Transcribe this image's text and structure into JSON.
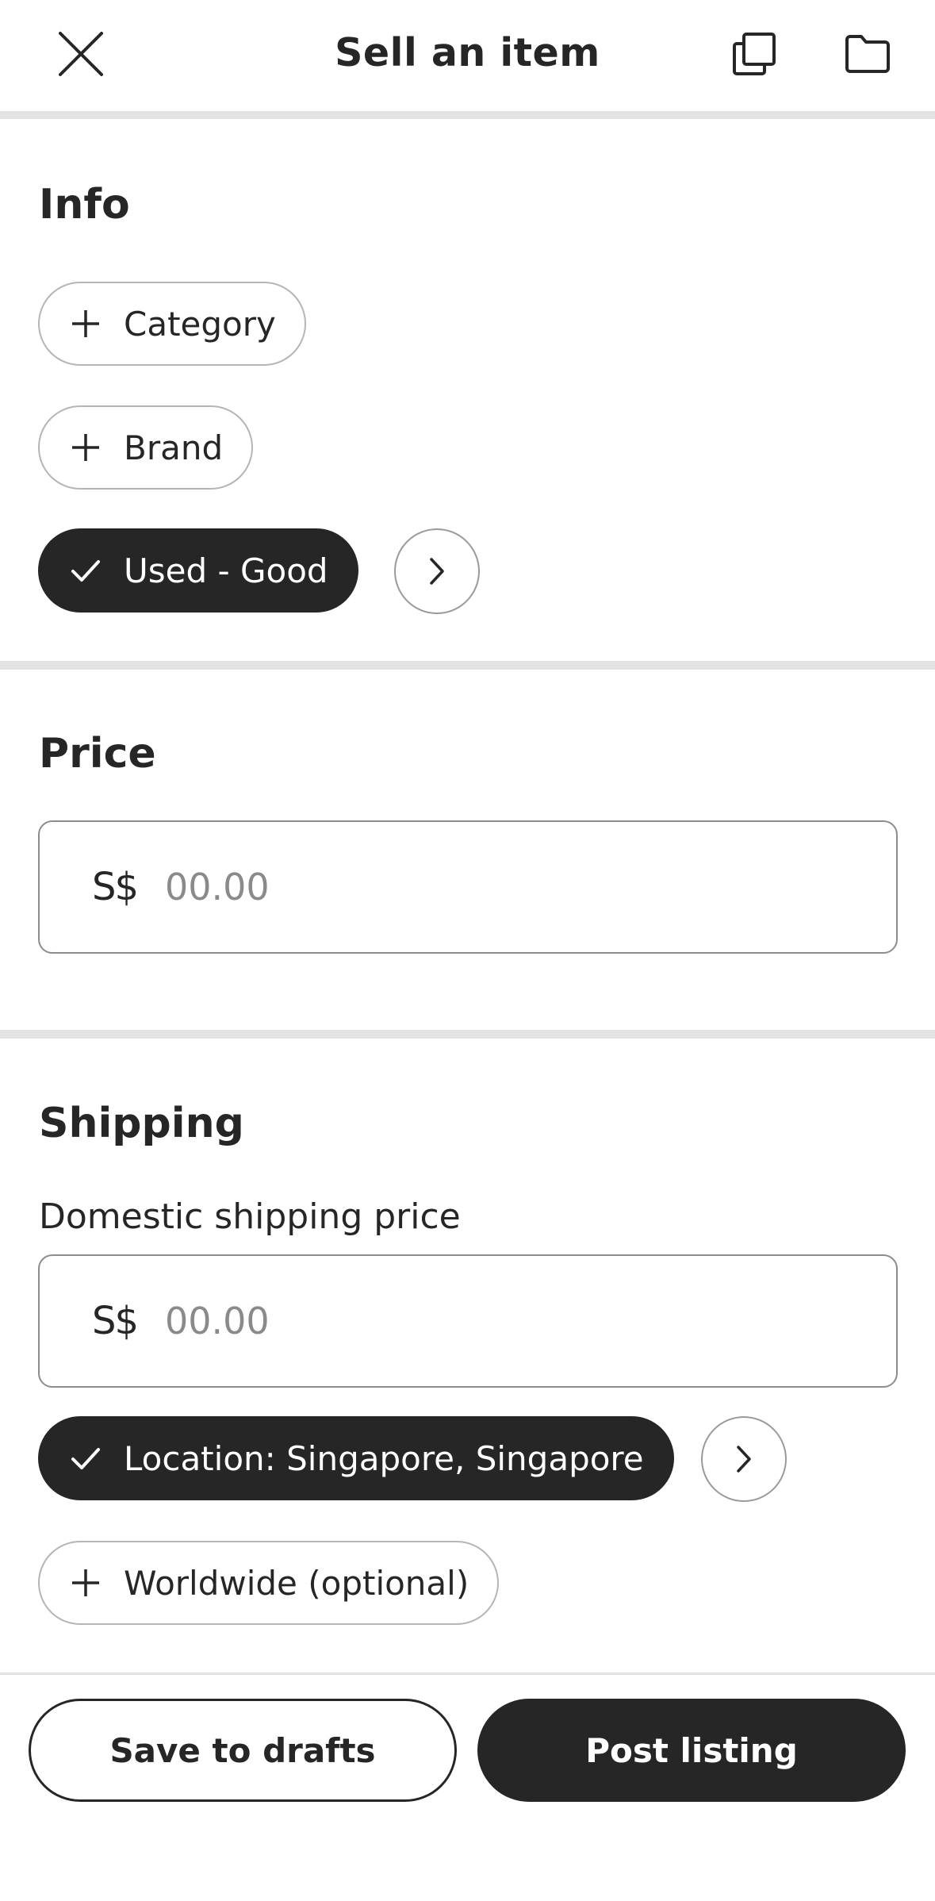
{
  "header": {
    "title": "Sell an item",
    "close_icon": "close-icon",
    "copy_icon": "copy-icon",
    "folder_icon": "folder-icon"
  },
  "info": {
    "title": "Info",
    "category_label": "Category",
    "brand_label": "Brand",
    "condition_label": "Used - Good"
  },
  "price": {
    "title": "Price",
    "currency": "S$",
    "placeholder": "00.00"
  },
  "shipping": {
    "title": "Shipping",
    "domestic_label": "Domestic shipping price",
    "currency": "S$",
    "placeholder": "00.00",
    "location_label": "Location: Singapore, Singapore",
    "worldwide_label": "Worldwide (optional)"
  },
  "footer": {
    "save_label": "Save to drafts",
    "post_label": "Post listing"
  },
  "colors": {
    "primary": "#262626",
    "divider": "#e3e3e3",
    "chip_border": "#b5b5b5"
  }
}
